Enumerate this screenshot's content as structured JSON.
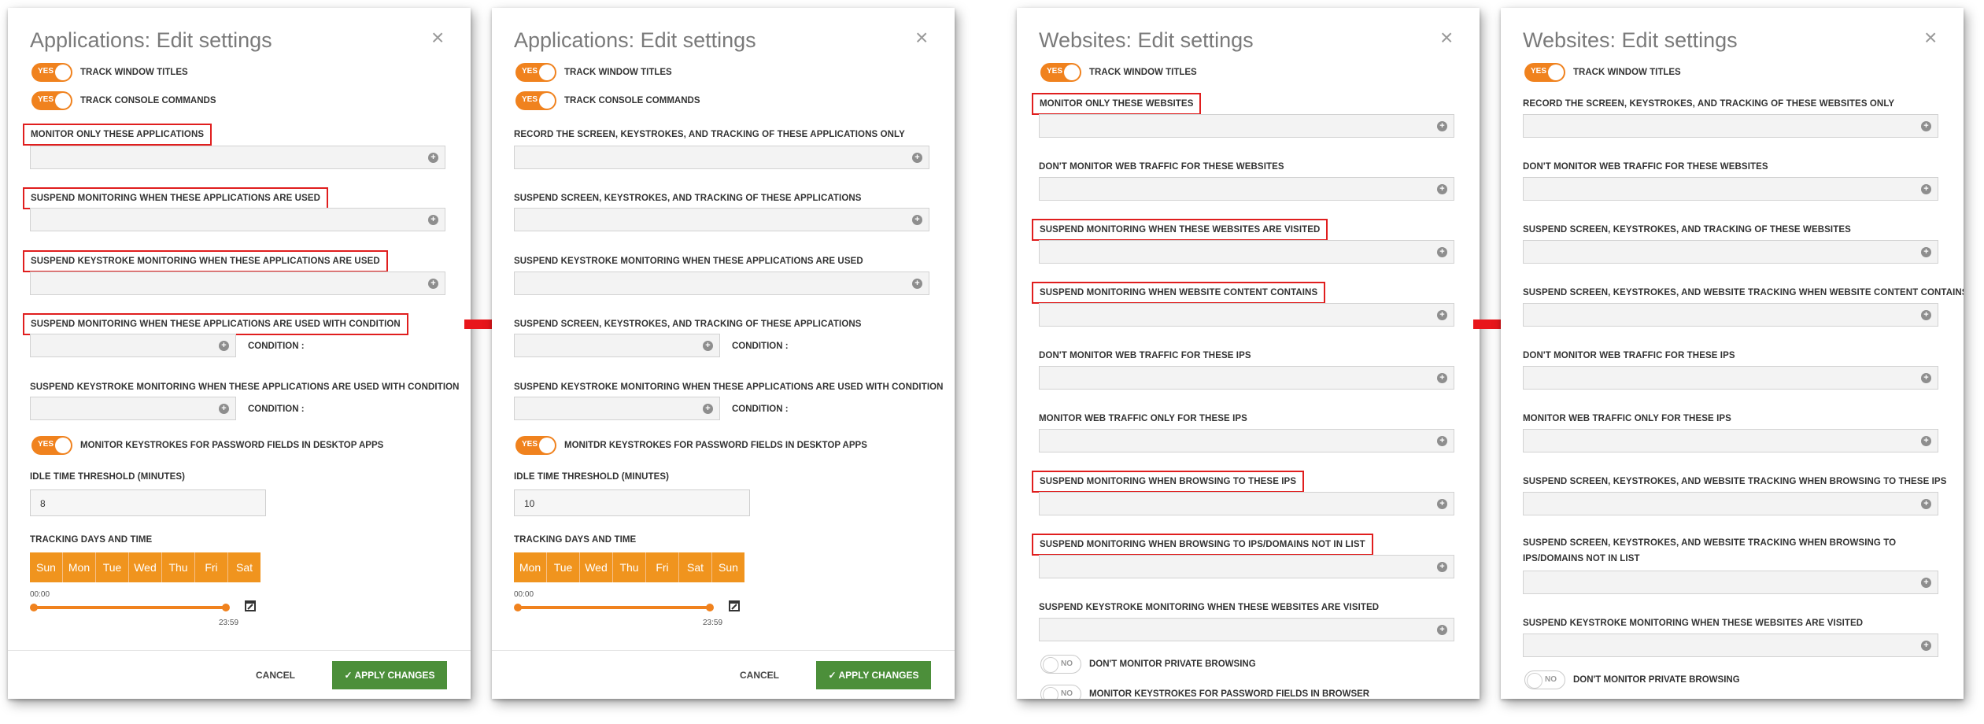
{
  "icons": {
    "close": "close-icon",
    "add": "plus-circle-icon",
    "arrow": "right-arrow-icon",
    "calendar": "calendar-icon",
    "check": "checkmark-icon"
  },
  "colors": {
    "accent": "#f0821e",
    "highlight": "#e01e1e",
    "apply": "#4c8f3a",
    "arrow": "#e8161b"
  },
  "close_glyph": "×",
  "plus_glyph": "+",
  "toggle_yes": "YES",
  "toggle_no": "NO",
  "panel1": {
    "title": "Applications: Edit settings",
    "track_window_titles": "TRACK WINDOW TITLES",
    "track_console_commands": "TRACK CONSOLE COMMANDS",
    "field1": "MONITOR ONLY THESE APPLICATIONS",
    "field2": "SUSPEND MONITORING WHEN THESE APPLICATIONS ARE USED",
    "field3": "SUSPEND KEYSTROKE MONITORING WHEN THESE APPLICATIONS ARE USED",
    "field4": "SUSPEND MONITORING WHEN THESE APPLICATIONS ARE USED WITH CONDITION",
    "field5": "SUSPEND KEYSTROKE MONITORING WHEN THESE APPLICATIONS ARE USED WITH CONDITION",
    "condition": "CONDITION :",
    "password_toggle": "MONITOR KEYSTROKES FOR PASSWORD FIELDS IN DESKTOP APPS",
    "idle_label": "IDLE TIME THRESHOLD (MINUTES)",
    "idle_value": "8",
    "tracking_label": "TRACKING DAYS AND TIME",
    "days": [
      "Sun",
      "Mon",
      "Tue",
      "Wed",
      "Thu",
      "Fri",
      "Sat"
    ],
    "time_start": "00:00",
    "time_end": "23:59",
    "cancel": "CANCEL",
    "apply": "APPLY CHANGES"
  },
  "panel2": {
    "title": "Applications: Edit settings",
    "track_window_titles": "TRACK WINDOW TITLES",
    "track_console_commands": "TRACK CONSOLE COMMANDS",
    "field1": "RECORD THE SCREEN, KEYSTROKES, AND TRACKING OF THESE APPLICATIONS ONLY",
    "field2": "SUSPEND SCREEN, KEYSTROKES, AND TRACKING OF THESE APPLICATIONS",
    "field3": "SUSPEND KEYSTROKE MONITORING WHEN THESE APPLICATIONS ARE USED",
    "field4": "SUSPEND SCREEN, KEYSTROKES, AND TRACKING OF THESE APPLICATIONS",
    "field5": "SUSPEND KEYSTROKE MONITORING WHEN THESE APPLICATIONS ARE USED WITH CONDITION",
    "condition": "CONDITION :",
    "password_toggle": "MONITDR KEYSTROKES FOR PASSWORD FIELDS IN DESKTOP APPS",
    "idle_label": "IDLE TIME THRESHOLD (MINUTES)",
    "idle_value": "10",
    "tracking_label": "TRACKING DAYS AND TIME",
    "days": [
      "Mon",
      "Tue",
      "Wed",
      "Thu",
      "Fri",
      "Sat",
      "Sun"
    ],
    "time_start": "00:00",
    "time_end": "23:59",
    "cancel": "CANCEL",
    "apply": "APPLY CHANGES"
  },
  "panel3": {
    "title": "Websites: Edit settings",
    "track_window_titles": "TRACK WINDOW TITLES",
    "fields": [
      "MONITOR ONLY THESE WEBSITES",
      "DON'T MONITOR WEB TRAFFIC FOR THESE WEBSITES",
      "SUSPEND MONITORING WHEN THESE WEBSITES ARE VISITED",
      "SUSPEND MONITORING WHEN WEBSITE CONTENT CONTAINS",
      "DON'T MONITOR WEB TRAFFIC FOR THESE IPS",
      "MONITOR WEB TRAFFIC ONLY FOR THESE IPS",
      "SUSPEND MONITORING WHEN BROWSING TO THESE IPS",
      "SUSPEND MONITORING WHEN BROWSING TO IPS/DOMAINS NOT IN LIST",
      "SUSPEND KEYSTROKE MONITORING WHEN THESE WEBSITES ARE VISITED"
    ],
    "private_browsing": "DON'T MONITOR PRIVATE BROWSING",
    "password_toggle": "MONITOR KEYSTROKES FOR PASSWORD FIELDS IN BROWSER"
  },
  "panel4": {
    "title": "Websites: Edit settings",
    "track_window_titles": "TRACK WINDOW TITLES",
    "fields": [
      "RECORD THE SCREEN, KEYSTROKES, AND TRACKING OF THESE WEBSITES ONLY",
      "DON'T MONITOR WEB TRAFFIC FOR THESE WEBSITES",
      "SUSPEND SCREEN, KEYSTROKES, AND TRACKING OF THESE WEBSITES",
      "SUSPEND SCREEN, KEYSTROKES, AND WEBSITE TRACKING WHEN WEBSITE CONTENT CONTAINS",
      "DON'T MONITOR WEB TRAFFIC FOR THESE IPS",
      "MONITOR WEB TRAFFIC ONLY FOR THESE IPS",
      "SUSPEND SCREEN, KEYSTROKES, AND WEBSITE TRACKING WHEN BROWSING TO THESE IPS",
      "SUSPEND SCREEN, KEYSTROKES, AND WEBSITE TRACKING WHEN BROWSING TO IPS/DOMAINS NOT IN LIST",
      "SUSPEND KEYSTROKE MONITORING WHEN THESE WEBSITES ARE VISITED"
    ],
    "private_browsing": "DON'T MONITOR PRIVATE BROWSING"
  }
}
